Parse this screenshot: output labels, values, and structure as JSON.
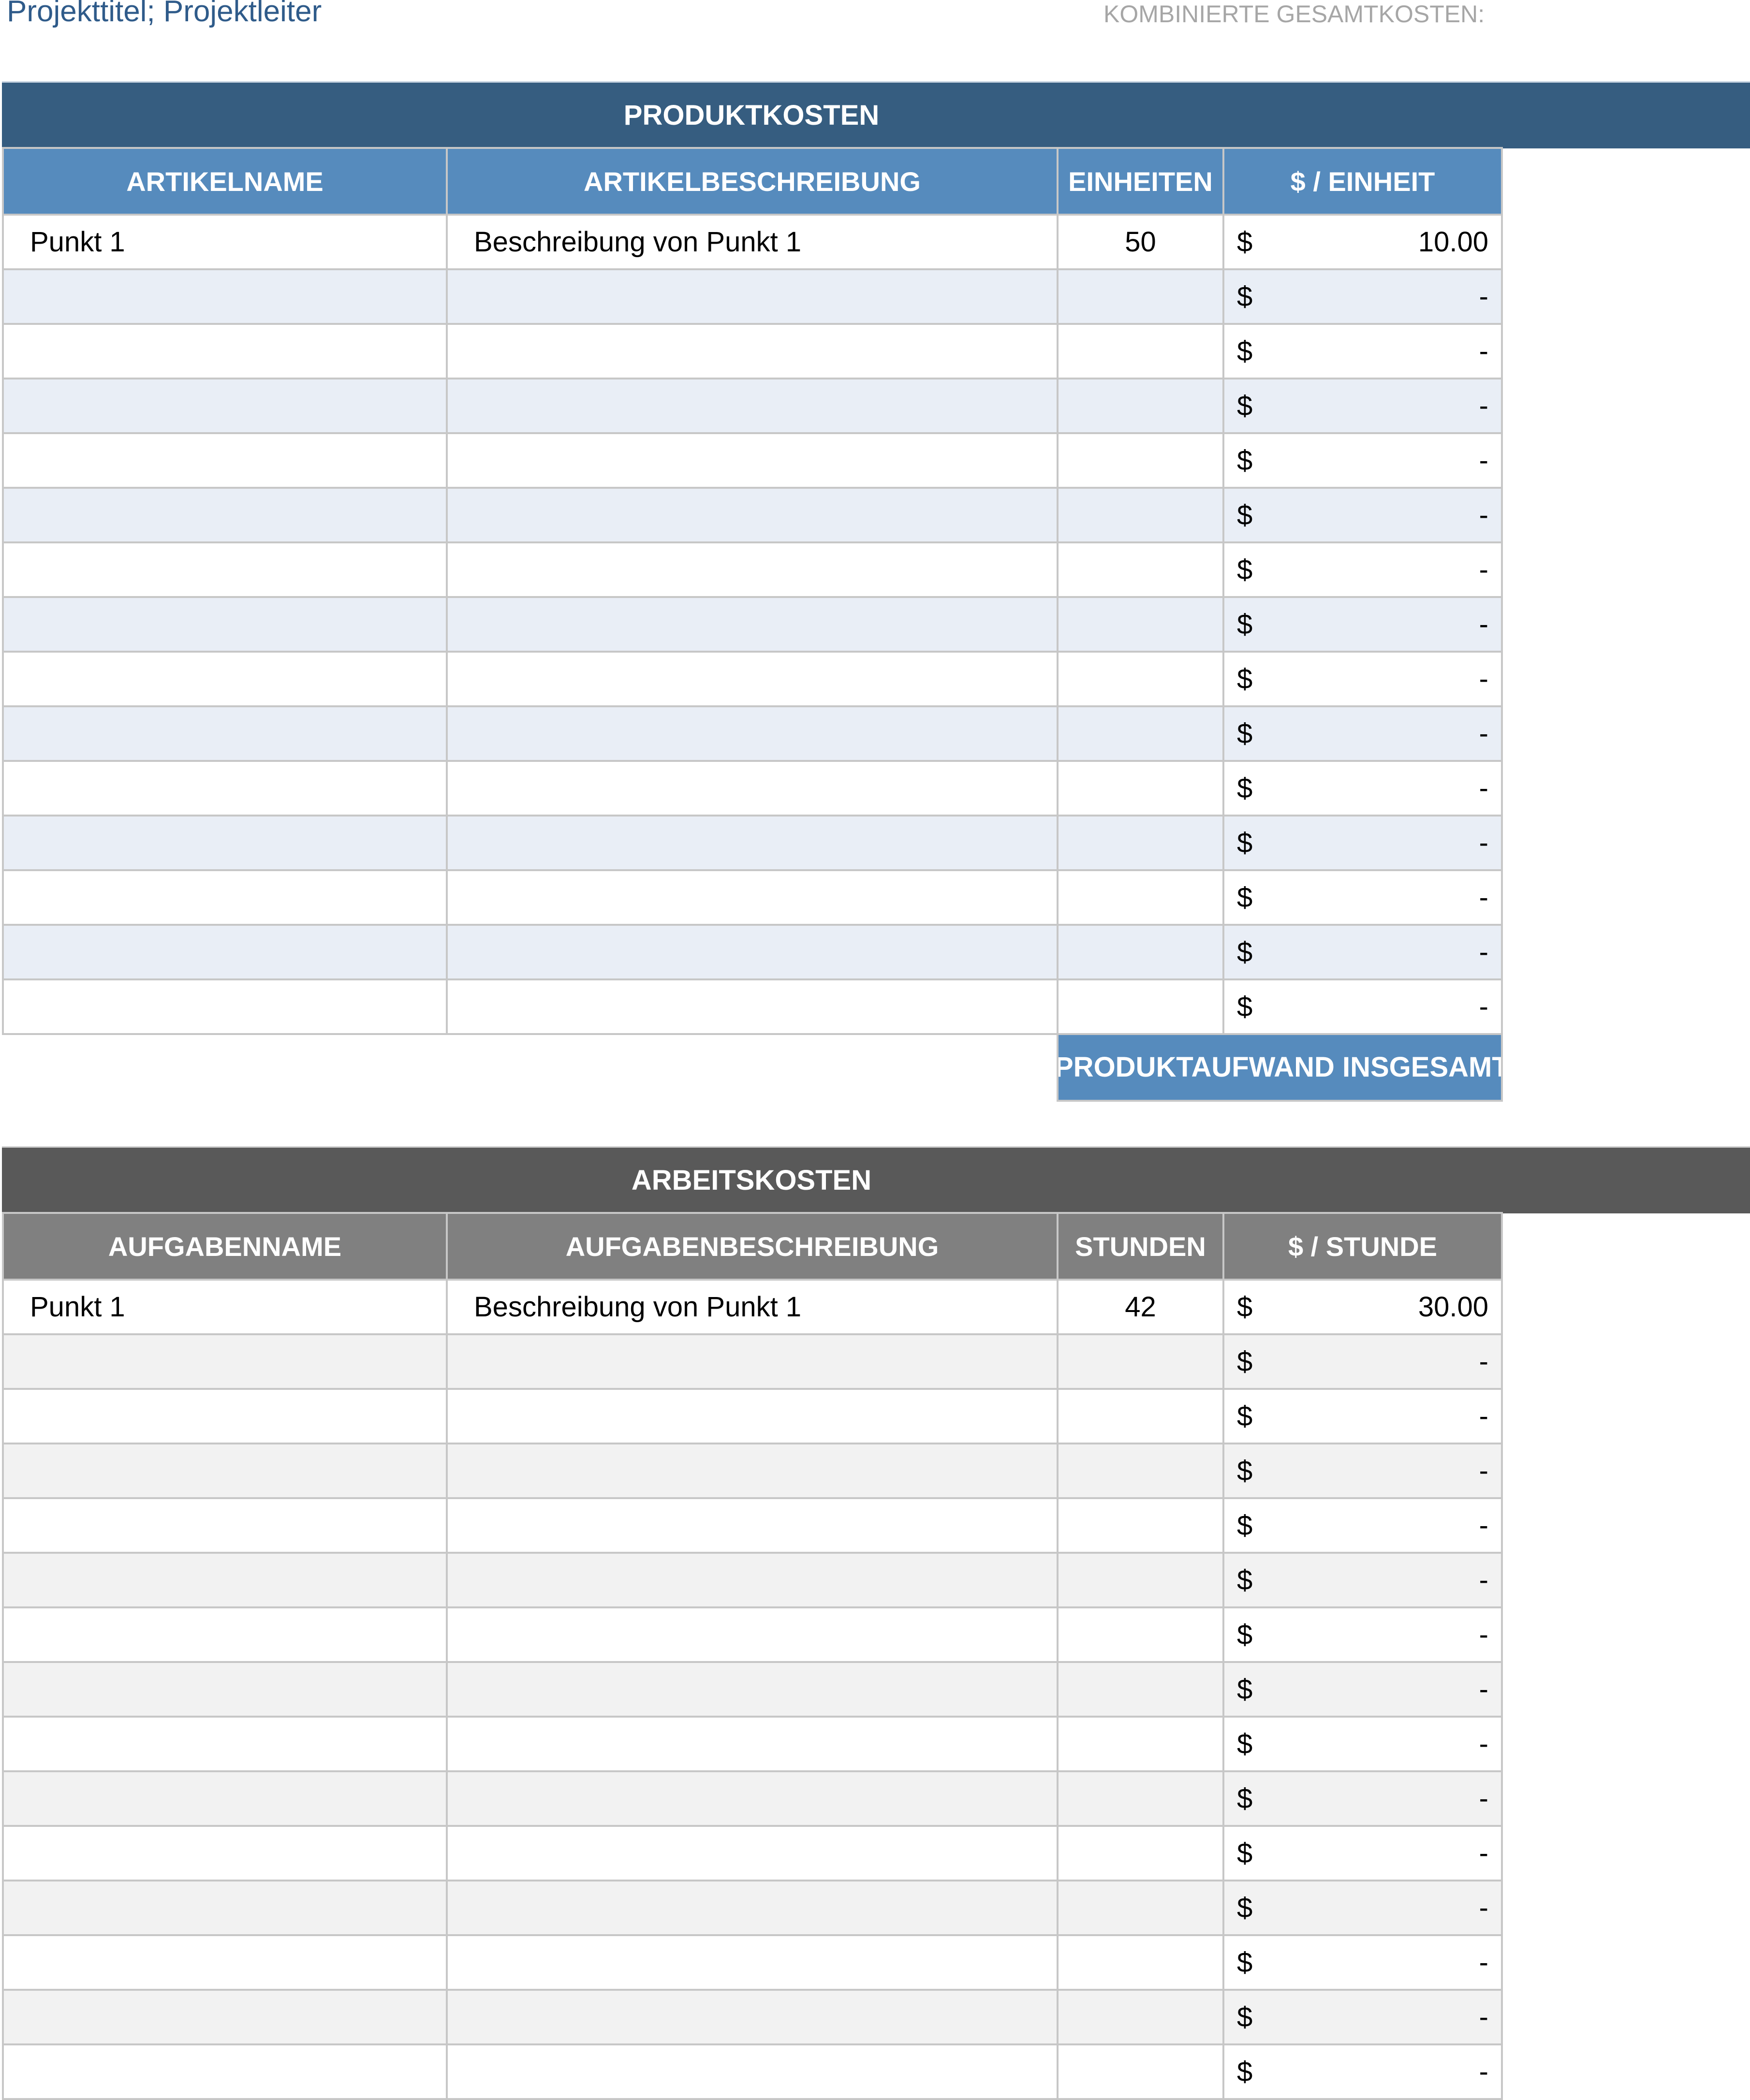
{
  "header": {
    "title": "Projekttitel; Projektleiter",
    "combined_total_label": "KOMBINIERTE GESAMTKOSTEN:"
  },
  "product_section": {
    "title": "PRODUKTKOSTEN",
    "columns": [
      "ARTIKELNAME",
      "ARTIKELBESCHREIBUNG",
      "EINHEITEN",
      "$ / EINHEIT"
    ],
    "rows": [
      {
        "name": "Punkt 1",
        "description": "Beschreibung von Punkt 1",
        "units": "50",
        "currency": "$",
        "price": "10.00"
      },
      {
        "name": "",
        "description": "",
        "units": "",
        "currency": "$",
        "price": "-"
      },
      {
        "name": "",
        "description": "",
        "units": "",
        "currency": "$",
        "price": "-"
      },
      {
        "name": "",
        "description": "",
        "units": "",
        "currency": "$",
        "price": "-"
      },
      {
        "name": "",
        "description": "",
        "units": "",
        "currency": "$",
        "price": "-"
      },
      {
        "name": "",
        "description": "",
        "units": "",
        "currency": "$",
        "price": "-"
      },
      {
        "name": "",
        "description": "",
        "units": "",
        "currency": "$",
        "price": "-"
      },
      {
        "name": "",
        "description": "",
        "units": "",
        "currency": "$",
        "price": "-"
      },
      {
        "name": "",
        "description": "",
        "units": "",
        "currency": "$",
        "price": "-"
      },
      {
        "name": "",
        "description": "",
        "units": "",
        "currency": "$",
        "price": "-"
      },
      {
        "name": "",
        "description": "",
        "units": "",
        "currency": "$",
        "price": "-"
      },
      {
        "name": "",
        "description": "",
        "units": "",
        "currency": "$",
        "price": "-"
      },
      {
        "name": "",
        "description": "",
        "units": "",
        "currency": "$",
        "price": "-"
      },
      {
        "name": "",
        "description": "",
        "units": "",
        "currency": "$",
        "price": "-"
      },
      {
        "name": "",
        "description": "",
        "units": "",
        "currency": "$",
        "price": "-"
      }
    ],
    "total_label": "PRODUKTAUFWAND INSGESAMT"
  },
  "labor_section": {
    "title": "ARBEITSKOSTEN",
    "columns": [
      "AUFGABENNAME",
      "AUFGABENBESCHREIBUNG",
      "STUNDEN",
      "$ / STUNDE"
    ],
    "rows": [
      {
        "name": "Punkt 1",
        "description": "Beschreibung von Punkt 1",
        "units": "42",
        "currency": "$",
        "price": "30.00"
      },
      {
        "name": "",
        "description": "",
        "units": "",
        "currency": "$",
        "price": "-"
      },
      {
        "name": "",
        "description": "",
        "units": "",
        "currency": "$",
        "price": "-"
      },
      {
        "name": "",
        "description": "",
        "units": "",
        "currency": "$",
        "price": "-"
      },
      {
        "name": "",
        "description": "",
        "units": "",
        "currency": "$",
        "price": "-"
      },
      {
        "name": "",
        "description": "",
        "units": "",
        "currency": "$",
        "price": "-"
      },
      {
        "name": "",
        "description": "",
        "units": "",
        "currency": "$",
        "price": "-"
      },
      {
        "name": "",
        "description": "",
        "units": "",
        "currency": "$",
        "price": "-"
      },
      {
        "name": "",
        "description": "",
        "units": "",
        "currency": "$",
        "price": "-"
      },
      {
        "name": "",
        "description": "",
        "units": "",
        "currency": "$",
        "price": "-"
      },
      {
        "name": "",
        "description": "",
        "units": "",
        "currency": "$",
        "price": "-"
      },
      {
        "name": "",
        "description": "",
        "units": "",
        "currency": "$",
        "price": "-"
      },
      {
        "name": "",
        "description": "",
        "units": "",
        "currency": "$",
        "price": "-"
      },
      {
        "name": "",
        "description": "",
        "units": "",
        "currency": "$",
        "price": "-"
      },
      {
        "name": "",
        "description": "",
        "units": "",
        "currency": "$",
        "price": "-"
      }
    ]
  }
}
